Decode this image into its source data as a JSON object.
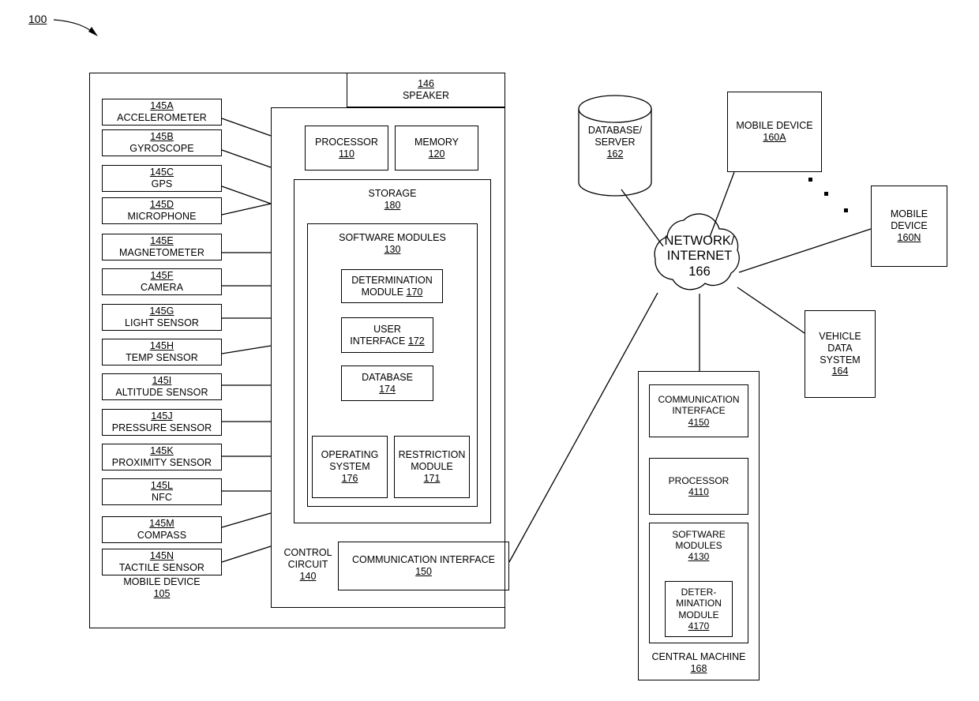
{
  "figure": {
    "number": "100"
  },
  "mobile_device": {
    "title": "MOBILE DEVICE",
    "number": "105",
    "sensors": [
      {
        "number": "145A",
        "label": "ACCELEROMETER"
      },
      {
        "number": "145B",
        "label": "GYROSCOPE"
      },
      {
        "number": "145C",
        "label": "GPS"
      },
      {
        "number": "145D",
        "label": "MICROPHONE"
      },
      {
        "number": "145E",
        "label": "MAGNETOMETER"
      },
      {
        "number": "145F",
        "label": "CAMERA"
      },
      {
        "number": "145G",
        "label": "LIGHT SENSOR"
      },
      {
        "number": "145H",
        "label": "TEMP SENSOR"
      },
      {
        "number": "145I",
        "label": "ALTITUDE SENSOR"
      },
      {
        "number": "145J",
        "label": "PRESSURE SENSOR"
      },
      {
        "number": "145K",
        "label": "PROXIMITY SENSOR"
      },
      {
        "number": "145L",
        "label": "NFC"
      },
      {
        "number": "145M",
        "label": "COMPASS"
      },
      {
        "number": "145N",
        "label": "TACTILE SENSOR"
      }
    ],
    "speaker": {
      "number": "146",
      "label": "SPEAKER"
    },
    "control_circuit": {
      "label": "CONTROL\nCIRCUIT",
      "number": "140"
    },
    "processor": {
      "label": "PROCESSOR",
      "number": "110"
    },
    "memory": {
      "label": "MEMORY",
      "number": "120"
    },
    "storage": {
      "label": "STORAGE",
      "number": "180"
    },
    "software_modules": {
      "label": "SOFTWARE MODULES",
      "number": "130"
    },
    "determination_module": {
      "label": "DETERMINATION\nMODULE ",
      "number": "170"
    },
    "user_interface": {
      "label": "USER\nINTERFACE ",
      "number": "172"
    },
    "database": {
      "label": "DATABASE",
      "number": "174"
    },
    "operating_system": {
      "label": "OPERATING\nSYSTEM",
      "number": "176"
    },
    "restriction_module": {
      "label": "RESTRICTION\nMODULE",
      "number": "171"
    },
    "communication_interface": {
      "label": "COMMUNICATION INTERFACE",
      "number": "150"
    }
  },
  "network": {
    "cloud": {
      "line1": "NETWORK/",
      "line2": "INTERNET",
      "number": "166"
    },
    "database_server": {
      "line1": "DATABASE/",
      "line2": "SERVER",
      "number": "162"
    },
    "mobile_device_a": {
      "label": "MOBILE DEVICE",
      "number": "160A"
    },
    "mobile_device_n": {
      "label": "MOBILE\nDEVICE",
      "number": "160N"
    },
    "vehicle_data_system": {
      "label": "VEHICLE\nDATA\nSYSTEM",
      "number": "164"
    },
    "ellipsis_dots": 3
  },
  "central_machine": {
    "title": "CENTRAL MACHINE",
    "number": "168",
    "communication_interface": {
      "label": "COMMUNICATION\nINTERFACE",
      "number": "4150"
    },
    "processor": {
      "label": "PROCESSOR",
      "number": "4110"
    },
    "software_modules": {
      "label": "SOFTWARE\nMODULES",
      "number": "4130"
    },
    "determination_module": {
      "label": "DETER-\nMINATION\nMODULE",
      "number": "4170"
    }
  },
  "colors": {
    "stroke": "#000000",
    "background": "#ffffff"
  }
}
